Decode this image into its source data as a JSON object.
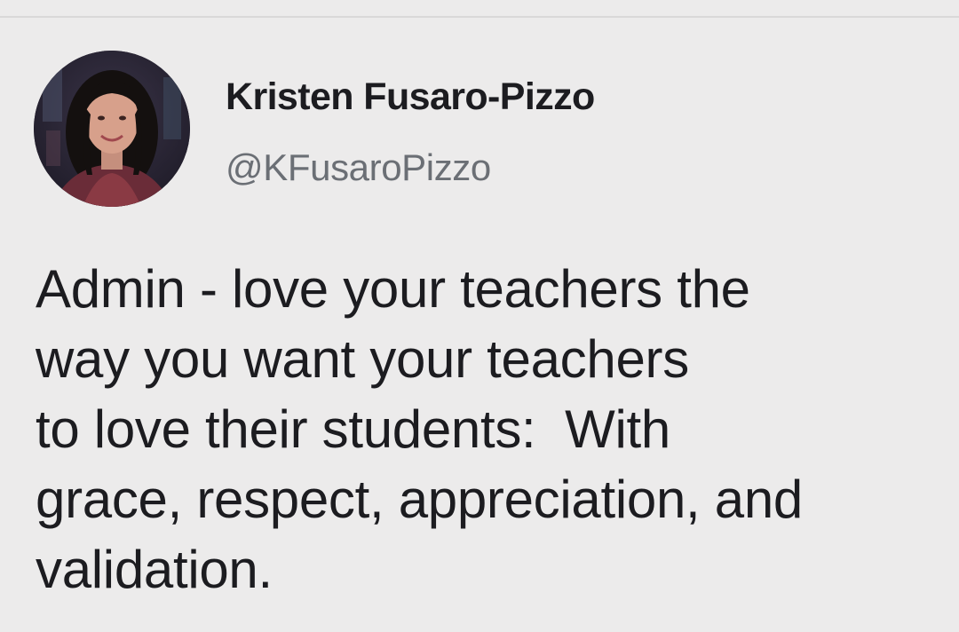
{
  "author": {
    "display_name": "Kristen Fusaro-Pizzo",
    "handle": "@KFusaroPizzo",
    "avatar": "profile-photo"
  },
  "tweet": {
    "lines": [
      "Admin - love your teachers the",
      "way you want your teachers",
      "to love their students:  With",
      "grace, respect, appreciation, and",
      "validation."
    ]
  },
  "colors": {
    "background": "#ecebeb",
    "text": "#1c1c20",
    "handle": "#6b6f75"
  }
}
